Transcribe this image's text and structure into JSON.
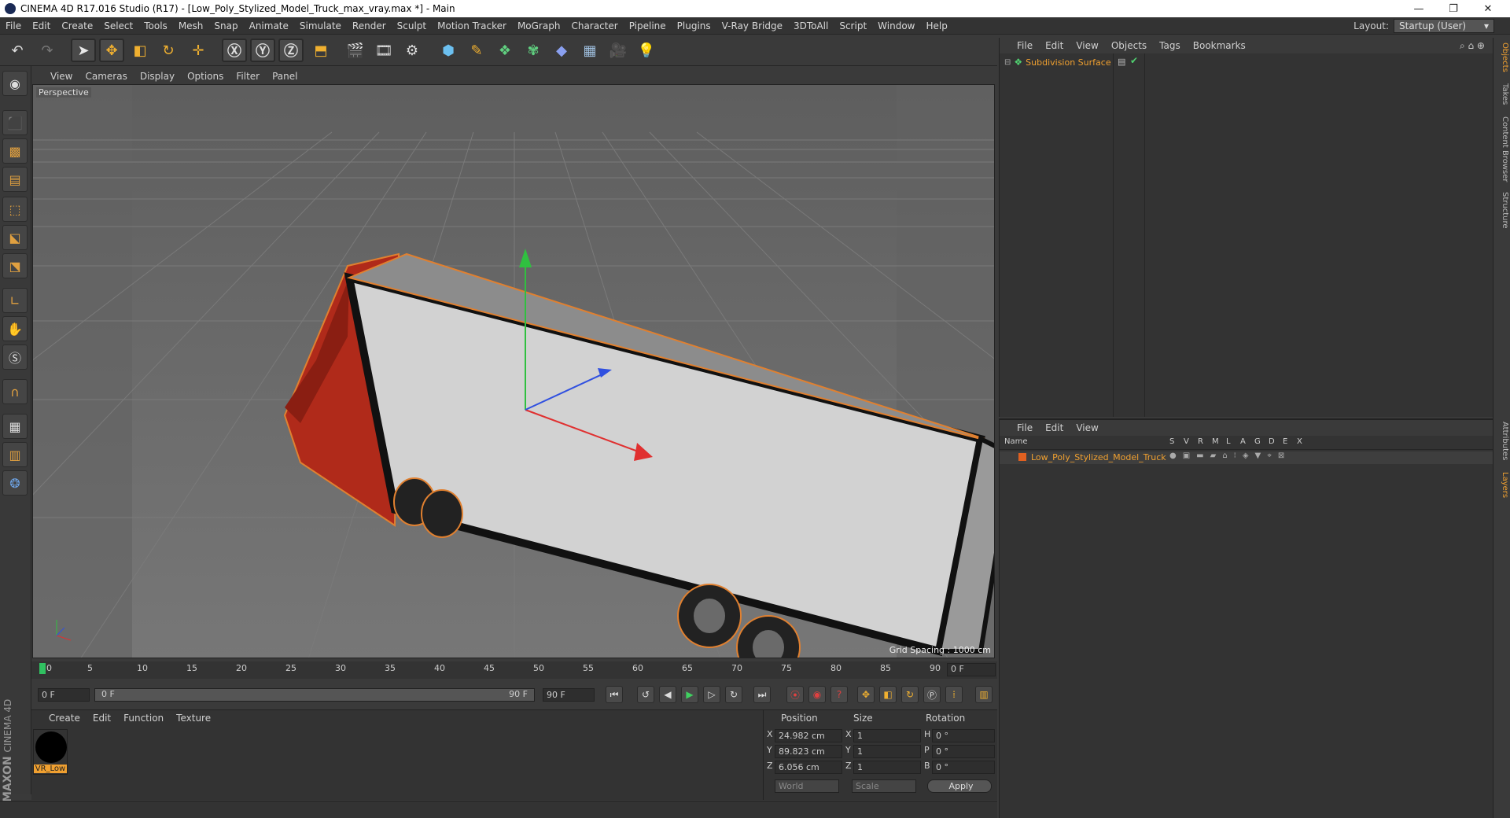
{
  "window": {
    "title": "CINEMA 4D R17.016 Studio (R17) - [Low_Poly_Stylized_Model_Truck_max_vray.max *] - Main",
    "minimize": "—",
    "restore": "❐",
    "close": "✕"
  },
  "menu": [
    "File",
    "Edit",
    "Create",
    "Select",
    "Tools",
    "Mesh",
    "Snap",
    "Animate",
    "Simulate",
    "Render",
    "Sculpt",
    "Motion Tracker",
    "MoGraph",
    "Character",
    "Pipeline",
    "Plugins",
    "V-Ray Bridge",
    "3DToAll",
    "Script",
    "Window",
    "Help"
  ],
  "layout": {
    "label": "Layout:",
    "value": "Startup (User)"
  },
  "toolbar_icons": [
    "undo-icon",
    "redo-icon",
    "select-arrow-icon",
    "move-icon",
    "scale-icon",
    "rotate-icon",
    "move-alt-icon",
    "x-axis-icon",
    "y-axis-icon",
    "z-axis-icon",
    "coordinate-system-icon",
    "render-view-icon",
    "render-picture-icon",
    "render-settings-icon",
    "cube-icon",
    "pen-icon",
    "subdivision-icon",
    "array-icon",
    "deformer-icon",
    "floor-icon",
    "camera-icon",
    "light-icon"
  ],
  "viewport": {
    "menu": [
      "View",
      "Cameras",
      "Display",
      "Options",
      "Filter",
      "Panel"
    ],
    "label": "Perspective",
    "grid_spacing": "Grid Spacing : 1000 cm"
  },
  "timeline": {
    "ticks": [
      "0",
      "5",
      "10",
      "15",
      "20",
      "25",
      "30",
      "35",
      "40",
      "45",
      "50",
      "55",
      "60",
      "65",
      "70",
      "75",
      "80",
      "85",
      "90"
    ],
    "current": "0 F"
  },
  "transport": {
    "start": "0 F",
    "range_start": "0 F",
    "range_end": "90 F",
    "end": "90 F"
  },
  "materials": {
    "menu": [
      "Create",
      "Edit",
      "Function",
      "Texture"
    ],
    "material_name": "VR_Low"
  },
  "coords": {
    "headers": [
      "Position",
      "Size",
      "Rotation"
    ],
    "rows": [
      {
        "axis": "X",
        "pos": "24.982 cm",
        "saxis": "X",
        "size": "1",
        "raxis": "H",
        "rot": "0 °"
      },
      {
        "axis": "Y",
        "pos": "89.823 cm",
        "saxis": "Y",
        "size": "1",
        "raxis": "P",
        "rot": "0 °"
      },
      {
        "axis": "Z",
        "pos": "6.056 cm",
        "saxis": "Z",
        "size": "1",
        "raxis": "B",
        "rot": "0 °"
      }
    ],
    "mode1": "World",
    "mode2": "Scale",
    "apply": "Apply"
  },
  "objects": {
    "menu": [
      "File",
      "Edit",
      "View",
      "Objects",
      "Tags",
      "Bookmarks"
    ],
    "items": [
      {
        "name": "Subdivision Surface"
      }
    ]
  },
  "layers": {
    "menu": [
      "File",
      "Edit",
      "View"
    ],
    "columns": [
      "Name",
      "S",
      "V",
      "R",
      "M",
      "L",
      "A",
      "G",
      "D",
      "E",
      "X"
    ],
    "items": [
      {
        "name": "Low_Poly_Stylized_Model_Truck"
      }
    ]
  },
  "right_tabs": [
    "Objects",
    "Takes",
    "Content Browser",
    "Structure",
    "Attributes",
    "Layers"
  ],
  "brand": {
    "maxon": "MAXON",
    "c4d": "CINEMA 4D"
  }
}
